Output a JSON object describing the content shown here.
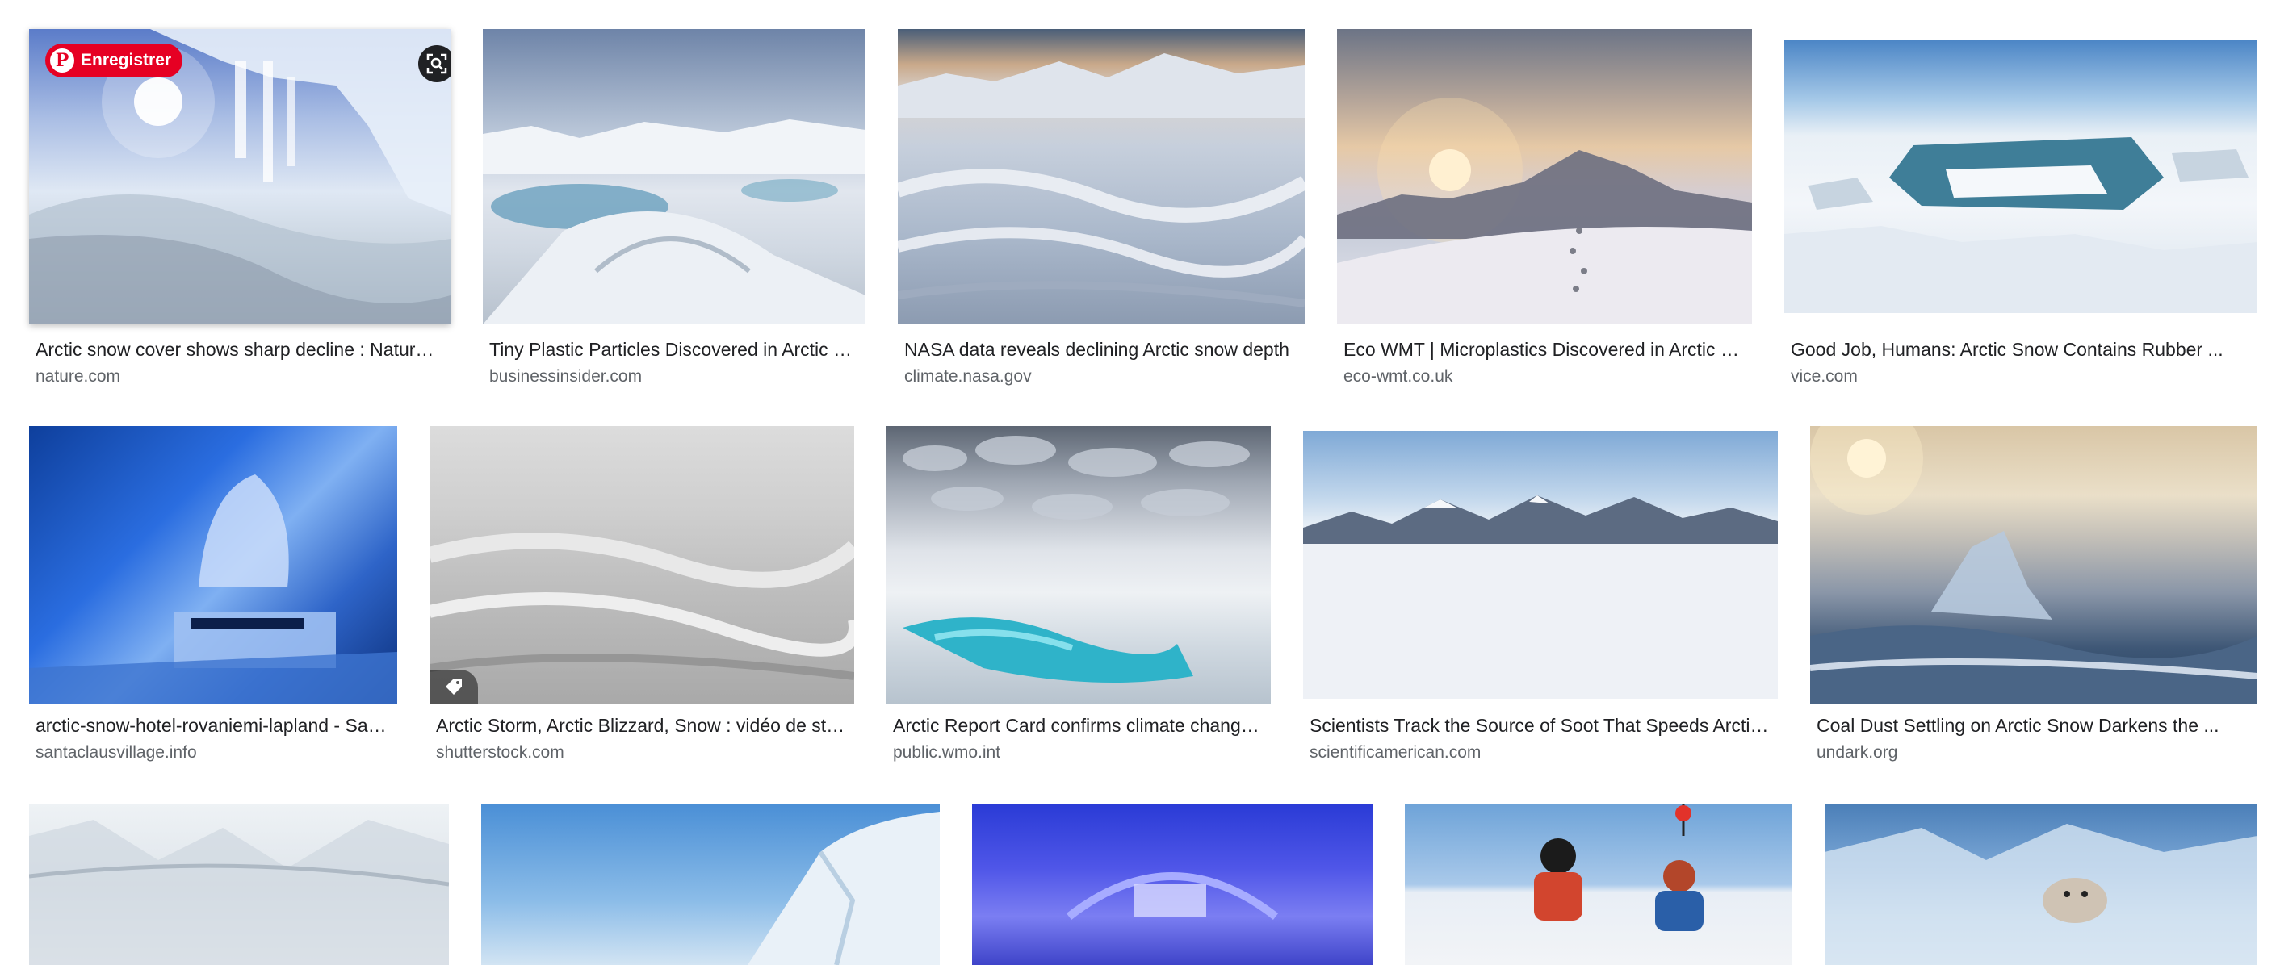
{
  "overlay": {
    "save_label": "Enregistrer"
  },
  "results": [
    {
      "title": "Arctic snow cover shows sharp decline : Nature ...",
      "source": "nature.com",
      "icon": "ice-cave-icicles-photo"
    },
    {
      "title": "Tiny Plastic Particles Discovered in Arctic Snow",
      "source": "businessinsider.com",
      "icon": "sea-ice-meltponds-photo"
    },
    {
      "title": "NASA data reveals declining Arctic snow depth",
      "source": "climate.nasa.gov",
      "icon": "snowfield-dunes-photo"
    },
    {
      "title": "Eco WMT | Microplastics Discovered in Arctic Snow",
      "source": "eco-wmt.co.uk",
      "icon": "snow-ridge-sunset-photo"
    },
    {
      "title": "Good Job, Humans: Arctic Snow Contains Rubber ...",
      "source": "vice.com",
      "icon": "pack-ice-aerial-photo"
    },
    {
      "title": "arctic-snow-hotel-rovaniemi-lapland - Santa ...",
      "source": "santaclausvillage.info",
      "icon": "ice-hotel-room-photo"
    },
    {
      "title": "Arctic Storm, Arctic Blizzard, Snow : vidéo de stock ...",
      "source": "shutterstock.com",
      "icon": "blizzard-snowfield-photo"
    },
    {
      "title": "Arctic Report Card confirms climate change ...",
      "source": "public.wmo.int",
      "icon": "melt-pool-clouds-photo"
    },
    {
      "title": "Scientists Track the Source of Soot That Speeds Arctic ...",
      "source": "scientificamerican.com",
      "icon": "frozen-fjord-mountains-photo"
    },
    {
      "title": "Coal Dust Settling on Arctic Snow Darkens the ...",
      "source": "undark.org",
      "icon": "ice-sunrise-photo"
    },
    {
      "title": "",
      "source": "",
      "icon": "snowy-valley-photo"
    },
    {
      "title": "",
      "source": "",
      "icon": "ice-wall-sky-photo"
    },
    {
      "title": "",
      "source": "",
      "icon": "ice-hall-blue-light-photo"
    },
    {
      "title": "",
      "source": "",
      "icon": "researchers-on-ice-photo"
    },
    {
      "title": "",
      "source": "",
      "icon": "seal-on-ice-photo"
    }
  ],
  "colors": {
    "pinterest_red": "#e60023",
    "title_text": "#202124",
    "source_text": "#5f6368"
  }
}
